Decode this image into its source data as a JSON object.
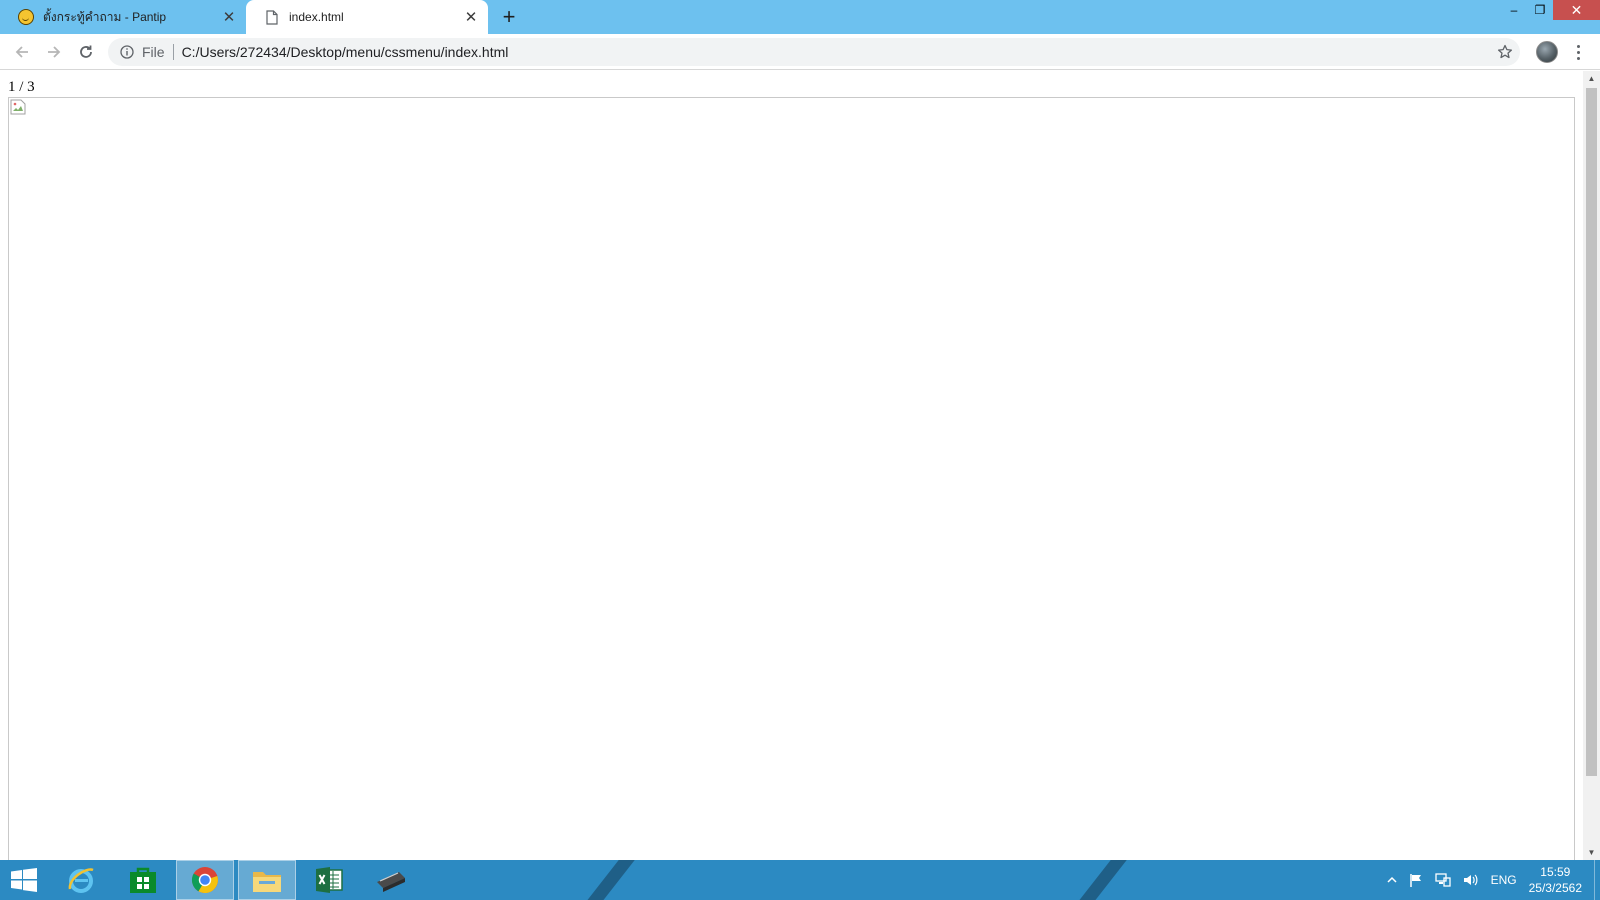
{
  "browser": {
    "tabs": [
      {
        "title": "ตั้งกระทู้คำถาม - Pantip",
        "favicon": "pantip-smiley-icon",
        "active": false
      },
      {
        "title": "index.html",
        "favicon": "document-icon",
        "active": true
      }
    ],
    "address_bar": {
      "scheme_label": "File",
      "url": "C:/Users/272434/Desktop/menu/cssmenu/index.html"
    },
    "window_controls": {
      "minimize": "–",
      "restore": "❐",
      "close": "✕"
    },
    "new_tab_symbol": "+",
    "tab_close_symbol": "✕"
  },
  "page": {
    "slide_counter": "1 / 3"
  },
  "taskbar": {
    "apps": [
      "windows-start-icon",
      "internet-explorer-icon",
      "windows-store-icon",
      "chrome-icon",
      "file-explorer-icon",
      "excel-icon",
      "scanner-icon"
    ],
    "active_app": "chrome-icon",
    "tray": {
      "language": "ENG",
      "time": "15:59",
      "date": "25/3/2562"
    }
  },
  "colors": {
    "titlebar": "#6dc1ef",
    "taskbar": "#2c8ac2",
    "close_button": "#c7504f"
  }
}
